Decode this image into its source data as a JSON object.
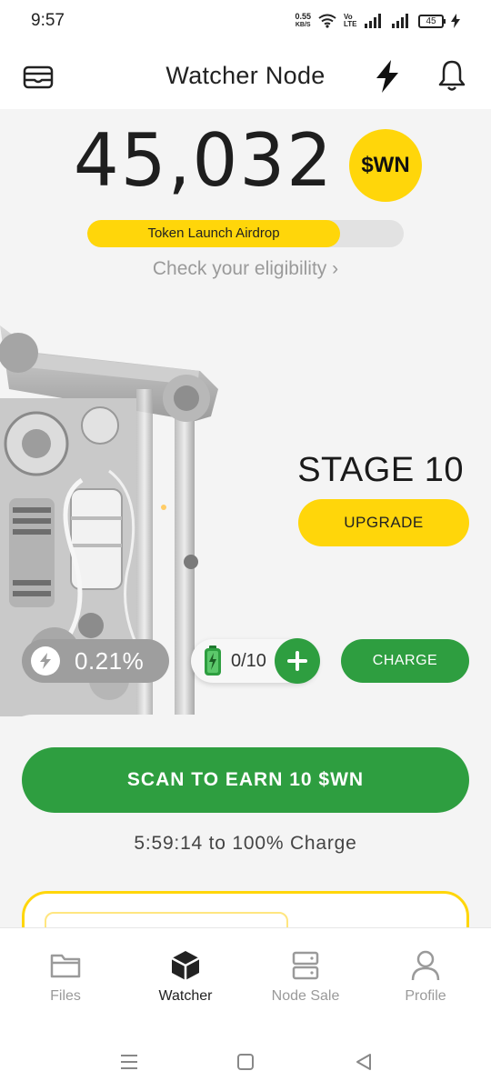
{
  "status_bar": {
    "time": "9:57",
    "net_speed_value": "0.55",
    "net_speed_unit": "KB/S",
    "volte": "Vo LTE",
    "battery": "45"
  },
  "header": {
    "title": "Watcher Node"
  },
  "balance": {
    "amount": "45,032",
    "token_badge": "$WN"
  },
  "airdrop": {
    "label": "Token Launch Airdrop",
    "progress_fraction": 0.8,
    "eligibility_link": "Check your eligibility ›"
  },
  "node": {
    "stage": "STAGE 10",
    "upgrade_label": "UPGRADE",
    "rate": "0.21%",
    "energy": "0/10",
    "charge_label": "CHARGE"
  },
  "actions": {
    "scan_label": "SCAN TO EARN 10 $WN",
    "charge_timer": "5:59:14  to 100% Charge"
  },
  "bottom_nav": {
    "items": [
      {
        "label": "Files",
        "icon": "folder-icon",
        "active": false
      },
      {
        "label": "Watcher",
        "icon": "cube-icon",
        "active": true
      },
      {
        "label": "Node Sale",
        "icon": "server-icon",
        "active": false
      },
      {
        "label": "Profile",
        "icon": "person-icon",
        "active": false
      }
    ]
  },
  "colors": {
    "accent_yellow": "#ffd60a",
    "accent_green": "#2e9e40",
    "rate_gray": "#9e9e9e"
  }
}
